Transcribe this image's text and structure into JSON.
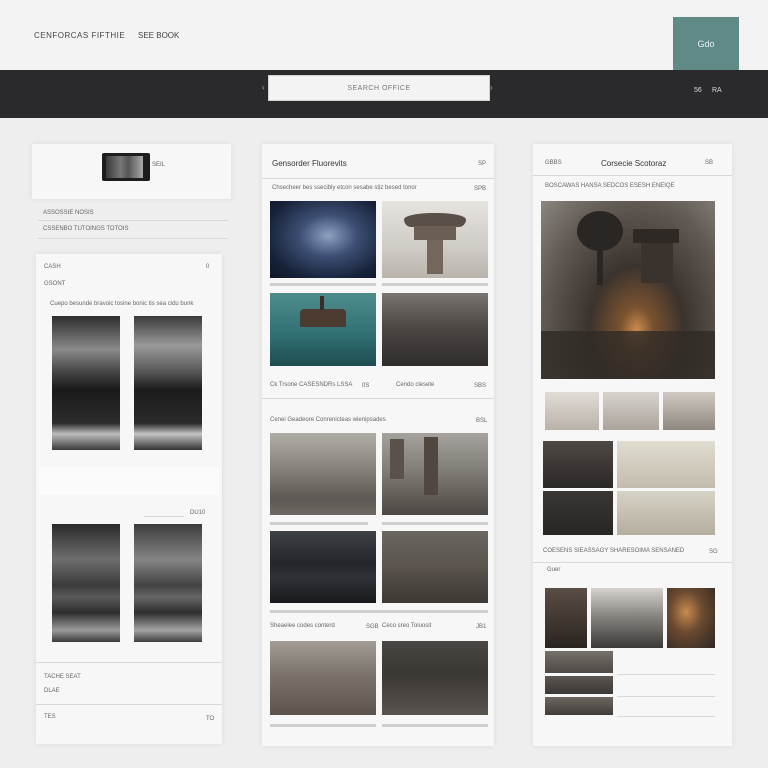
{
  "topbar": {
    "brand": "CENFORCAS FIFTHIE",
    "nav_item": "SEE BOOK",
    "cta_label": "Gdo"
  },
  "toolbar": {
    "search_placeholder": "SEARCH OFFICE",
    "right_item_1": "56",
    "right_item_2": "RA"
  },
  "left_panel": {
    "device_label": "SEIL",
    "meta_1": "ASSOSSIE NOSIS",
    "meta_2": "CSSENBO TUTOINGS TOTOIS",
    "card_title": "CASH",
    "card_count": "0",
    "card_sub": "GSONT",
    "card_caption": "Cuepo besunde bravoic tosine bonic tis sea cidu bunk",
    "mid_tag": "DU10",
    "footer_1": "TACHE SEAT",
    "footer_2": "DLAE",
    "footer_3": "TES",
    "footer_count": "TO"
  },
  "center_panel": {
    "title": "Gensorder Fluorevits",
    "title_count": "SP",
    "caption_1": "Chsecheer bes ssecibly etcon sesabe stiz besed tonor",
    "caption_1_count": "SPB",
    "row_label_1": "Ck Trsone CASESNDRs LSSA",
    "row_label_1_count": "0S",
    "row_label_2": "Cendo clesete",
    "row_label_2_count": "SBS",
    "section_2_title": "Cenei Geadeore Conrenicteas wienipsades",
    "section_2_count": "BSL",
    "row_label_3": "Sheaelee codes conterd",
    "row_label_3_count": "SGB",
    "row_label_4": "Ceco sreo Toluosit",
    "row_label_4_count": "JB1"
  },
  "right_panel": {
    "tag": "GBBS",
    "title": "Corsecie Scotoraz",
    "title_count": "SB",
    "caption_1": "BOSCAWAS HANSA SEDCOS ESESH ENEIQE",
    "caption_2": "COESENS SIEASSAGY SHARESOIMA SENSANED",
    "caption_2_count": "SG",
    "tag_2": "Guer"
  },
  "colors": {
    "accent": "#5f8a86",
    "toolbar_bg": "#2a2a2c",
    "page_bg": "#eeeeee",
    "panel_bg": "#f7f7f7"
  },
  "icons": {
    "device": "tablet-thumbnail-icon"
  }
}
